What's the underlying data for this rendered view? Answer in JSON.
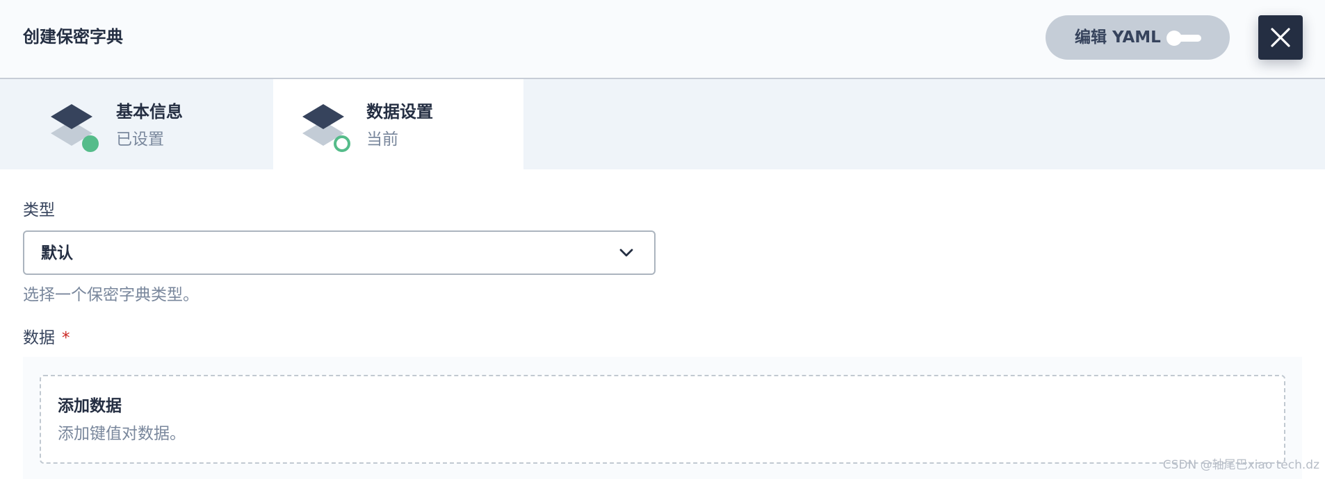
{
  "header": {
    "title": "创建保密字典",
    "yaml_button_label": "编辑 YAML",
    "yaml_toggle_on": false
  },
  "steps": [
    {
      "title": "基本信息",
      "status": "已设置",
      "state": "done"
    },
    {
      "title": "数据设置",
      "status": "当前",
      "state": "current"
    }
  ],
  "form": {
    "type": {
      "label": "类型",
      "value": "默认",
      "hint": "选择一个保密字典类型。"
    },
    "data": {
      "label": "数据",
      "required_mark": "*",
      "add_title": "添加数据",
      "add_description": "添加键值对数据。"
    }
  },
  "watermark": "CSDN @轴尾巴xiao tech.dz",
  "colors": {
    "accent_green": "#55bc8a",
    "dark": "#242e42",
    "muted_text": "#79879c",
    "required": "#ca2621"
  },
  "icons": {
    "close": "close-icon",
    "chevron": "chevron-down-icon",
    "step": "layers-icon"
  }
}
